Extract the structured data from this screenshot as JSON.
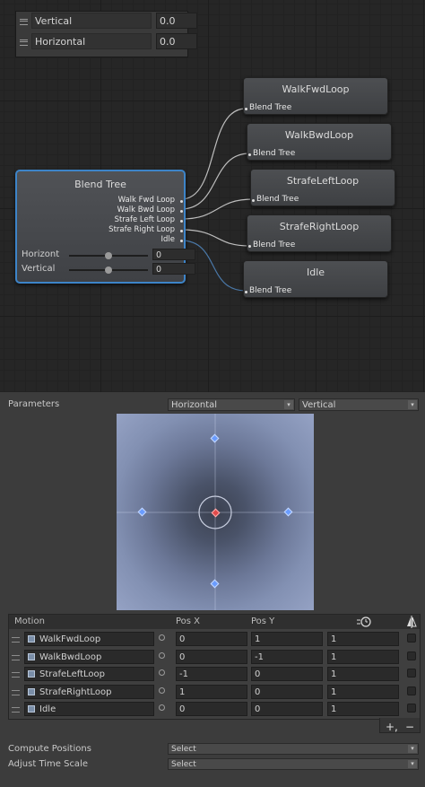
{
  "parameters_panel": {
    "rows": [
      {
        "name": "Vertical",
        "value": "0.0"
      },
      {
        "name": "Horizontal",
        "value": "0.0"
      }
    ]
  },
  "blend_tree_node": {
    "title": "Blend Tree",
    "outputs": [
      "Walk Fwd Loop",
      "Walk Bwd Loop",
      "Strafe Left Loop",
      "Strafe Right Loop",
      "Idle"
    ],
    "sliders": [
      {
        "label": "Horizont",
        "value": "0",
        "level": 0.5
      },
      {
        "label": "Vertical",
        "value": "0",
        "level": 0.5
      }
    ]
  },
  "clip_nodes": [
    {
      "title": "WalkFwdLoop",
      "port": "Blend Tree"
    },
    {
      "title": "WalkBwdLoop",
      "port": "Blend Tree"
    },
    {
      "title": "StrafeLeftLoop",
      "port": "Blend Tree"
    },
    {
      "title": "StrafeRightLoop",
      "port": "Blend Tree"
    },
    {
      "title": "Idle",
      "port": "Blend Tree"
    }
  ],
  "inspector": {
    "parameters_label": "Parameters",
    "param_x": "Horizontal",
    "param_y": "Vertical",
    "table": {
      "headers": {
        "motion": "Motion",
        "pos_x": "Pos X",
        "pos_y": "Pos Y"
      },
      "rows": [
        {
          "motion": "WalkFwdLoop",
          "pos_x": "0",
          "pos_y": "1",
          "speed": "1"
        },
        {
          "motion": "WalkBwdLoop",
          "pos_x": "0",
          "pos_y": "-1",
          "speed": "1"
        },
        {
          "motion": "StrafeLeftLoop",
          "pos_x": "-1",
          "pos_y": "0",
          "speed": "1"
        },
        {
          "motion": "StrafeRightLoop",
          "pos_x": "1",
          "pos_y": "0",
          "speed": "1"
        },
        {
          "motion": "Idle",
          "pos_x": "0",
          "pos_y": "0",
          "speed": "1"
        }
      ]
    },
    "add_label": "+,",
    "remove_label": "−",
    "compute_positions_label": "Compute Positions",
    "compute_positions_value": "Select",
    "adjust_time_scale_label": "Adjust Time Scale",
    "adjust_time_scale_value": "Select"
  },
  "colors": {
    "selection_border": "#3d84c8",
    "motion_point": "#6a9cff",
    "current_point": "#e04a4a"
  },
  "icons": [
    "drag-handle-icon",
    "animation-clip-icon",
    "circle-target-icon",
    "speed-clock-icon",
    "mirror-icon",
    "dropdown-arrow-icon"
  ]
}
